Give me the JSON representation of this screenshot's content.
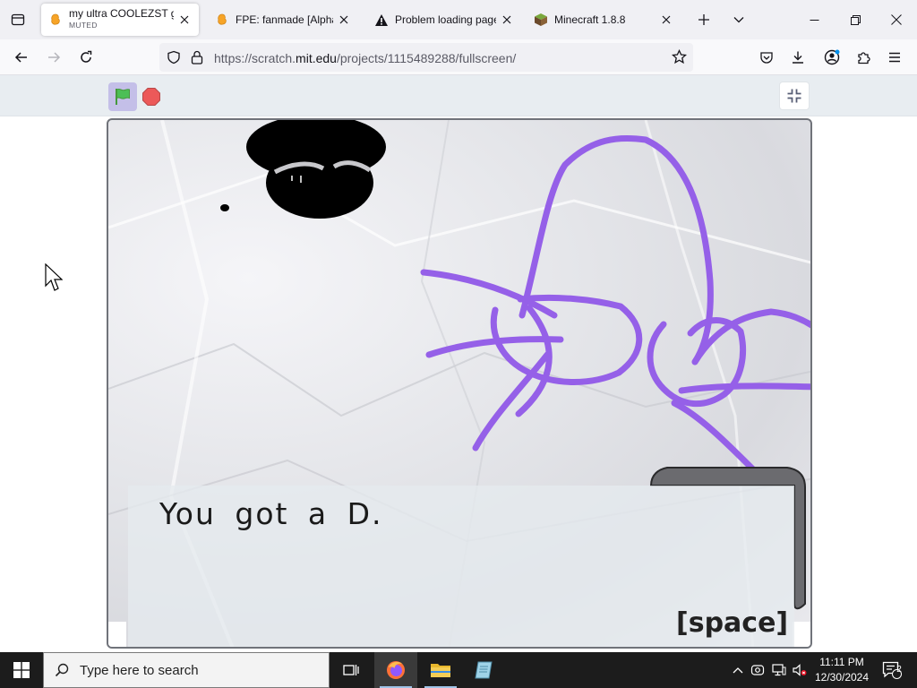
{
  "browser": {
    "tabs": [
      {
        "title": "my ultra COOLEZST game",
        "subtitle": "MUTED",
        "active": true
      },
      {
        "title": "FPE: fanmade [Alpha] [",
        "active": false
      },
      {
        "title": "Problem loading page",
        "active": false
      },
      {
        "title": "Minecraft 1.8.8",
        "active": false
      }
    ],
    "url_prefix": "https://scratch.",
    "url_domain": "mit.edu",
    "url_path": "/projects/1115489288/fullscreen/"
  },
  "stage": {
    "dialog_text": "You got a D.",
    "hint_text": "[space]",
    "drawing_color": "#9560e8"
  },
  "taskbar": {
    "search_placeholder": "Type here to search",
    "time": "11:11 PM",
    "date": "12/30/2024",
    "notification_count": "2"
  }
}
